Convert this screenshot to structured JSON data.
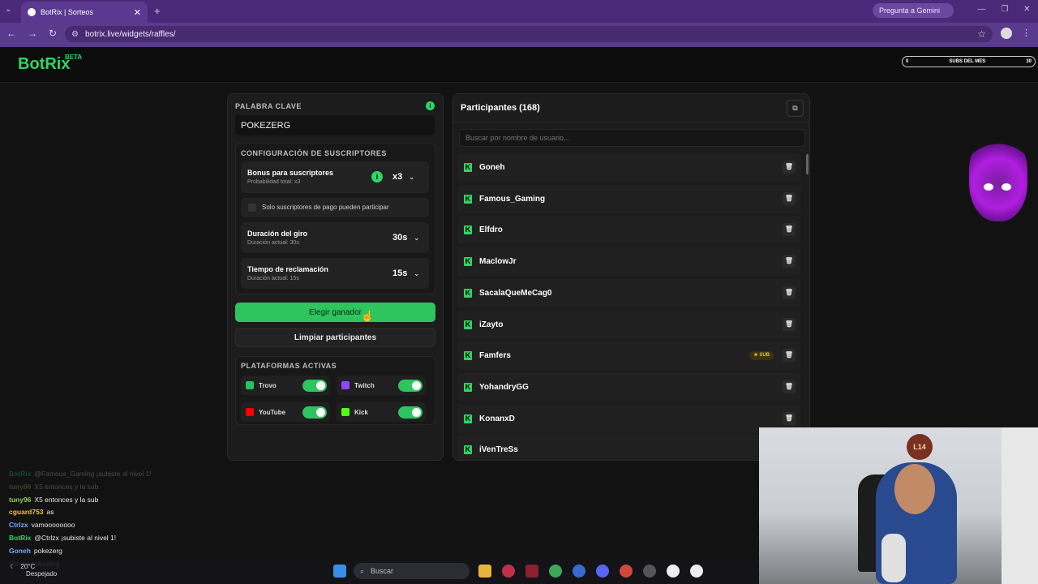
{
  "browser": {
    "tab_title": "BotRix | Sorteos",
    "tab_close": "✕",
    "new_tab": "+",
    "gemini": "Pregunta a Gemini",
    "url": "botrix.live/widgets/raffles/",
    "nav": {
      "back": "←",
      "forward": "→",
      "reload": "↻"
    },
    "star": "☆",
    "menu": "⋮"
  },
  "header": {
    "logo": "BotRix",
    "beta": "BETA",
    "subs_left": "0",
    "subs_label": "SUBS DEL MES",
    "subs_right": "30"
  },
  "keyword": {
    "label": "PALABRA CLAVE",
    "value": "POKEZERG",
    "info": "i"
  },
  "subscriber_config": {
    "label": "CONFIGURACIÓN DE SUSCRIPTORES",
    "bonus": {
      "title": "Bonus para suscriptores",
      "sub": "Probabilidad total: x3",
      "value": "x3",
      "info": "i"
    },
    "paid_only": "Solo suscriptores de pago pueden participar",
    "spin": {
      "title": "Duración del giro",
      "sub": "Duración actual: 30s",
      "value": "30s"
    },
    "claim": {
      "title": "Tiempo de reclamación",
      "sub": "Duración actual: 15s",
      "value": "15s"
    },
    "chevron": "⌄"
  },
  "actions": {
    "pick_winner": "Elegir ganador",
    "clear": "Limpiar participantes"
  },
  "platforms": {
    "label": "PLATAFORMAS ACTIVAS",
    "items": [
      {
        "name": "Trovo",
        "color": "#22c55e"
      },
      {
        "name": "Twitch",
        "color": "#9146ff"
      },
      {
        "name": "YouTube",
        "color": "#ff0000"
      },
      {
        "name": "Kick",
        "color": "#53fc18"
      }
    ]
  },
  "participants": {
    "title": "Participantes (168)",
    "copy_icon": "⧉",
    "search_placeholder": "Buscar por nombre de usuario...",
    "badge_sub": "★ SUB",
    "trash": "🗑",
    "list": [
      "Goneh",
      "Famous_Gaming",
      "Elfdro",
      "MaclowJr",
      "SacalaQueMeCag0",
      "iZayto",
      "Famfers",
      "YohandryGG",
      "KonanxD",
      "iVenTreSs"
    ],
    "sub_index": 6
  },
  "chat": [
    {
      "user": "BotRix",
      "text": "@Famous_Gaming ¡subiste al nivel 1!",
      "color": "#2fd665",
      "faded": true
    },
    {
      "user": "tuny96",
      "text": "X5 entonces y la sub",
      "color": "#8fd14f",
      "faded": true
    },
    {
      "user": "tuny96",
      "text": "X5 entonces y la sub",
      "color": "#8fd14f",
      "faded": false
    },
    {
      "user": "cguard753",
      "text": "as",
      "color": "#f0c040",
      "faded": false
    },
    {
      "user": "Ctrlzx",
      "text": "vamoooooooo",
      "color": "#7aa7ff",
      "faded": false
    },
    {
      "user": "BotRix",
      "text": "@Ctrlzx ¡subiste al nivel 1!",
      "color": "#2fd665",
      "faded": false
    },
    {
      "user": "Goneh",
      "text": "pokezerg",
      "color": "#7aa7ff",
      "faded": false
    },
    {
      "user": "Ctrlzx",
      "text": "pokezerg",
      "color": "#7aa7ff",
      "faded": false
    }
  ],
  "webcam": {
    "logo": "L14"
  },
  "taskbar": {
    "weather_temp": "20°C",
    "weather_desc": "Despejado",
    "search": "Buscar"
  }
}
